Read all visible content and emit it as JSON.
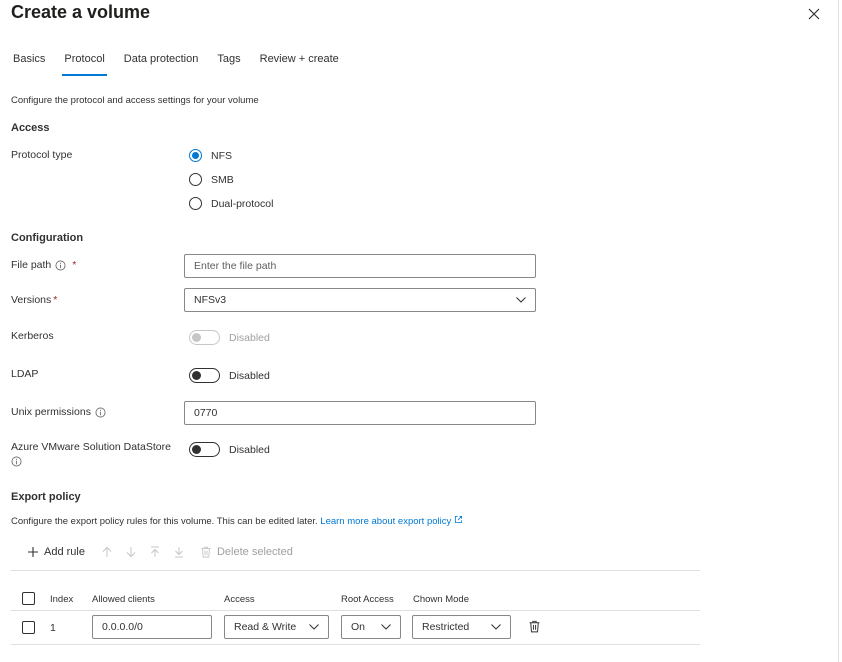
{
  "window": {
    "title": "Create a volume"
  },
  "tabs": [
    {
      "label": "Basics",
      "active": false
    },
    {
      "label": "Protocol",
      "active": true
    },
    {
      "label": "Data protection",
      "active": false
    },
    {
      "label": "Tags",
      "active": false
    },
    {
      "label": "Review + create",
      "active": false
    }
  ],
  "description": "Configure the protocol and access settings for your volume",
  "access": {
    "heading": "Access",
    "protocol_label": "Protocol type",
    "options": [
      "NFS",
      "SMB",
      "Dual-protocol"
    ],
    "selected": "NFS"
  },
  "configuration": {
    "heading": "Configuration",
    "file_path": {
      "label": "File path",
      "required_mark": "*",
      "placeholder": "Enter the file path",
      "value": ""
    },
    "versions": {
      "label": "Versions",
      "required_mark": "*",
      "value": "NFSv3"
    },
    "kerberos": {
      "label": "Kerberos",
      "state": "Disabled"
    },
    "ldap": {
      "label": "LDAP",
      "state": "Disabled"
    },
    "unix_permissions": {
      "label": "Unix permissions",
      "value": "0770"
    },
    "avs_datastore": {
      "label": "Azure VMware Solution DataStore",
      "state": "Disabled"
    }
  },
  "export_policy": {
    "heading": "Export policy",
    "description": "Configure the export policy rules for this volume. This can be edited later.",
    "learn_more": "Learn more about export policy",
    "toolbar": {
      "add_rule": "Add rule",
      "delete_selected": "Delete selected"
    },
    "columns": [
      "Index",
      "Allowed clients",
      "Access",
      "Root Access",
      "Chown Mode"
    ],
    "rows": [
      {
        "index": "1",
        "allowed_clients": "0.0.0.0/0",
        "access": "Read & Write",
        "root_access": "On",
        "chown_mode": "Restricted"
      }
    ]
  },
  "colors": {
    "accent": "#0078d4",
    "required": "#a4262c",
    "border": "#8a8886"
  }
}
